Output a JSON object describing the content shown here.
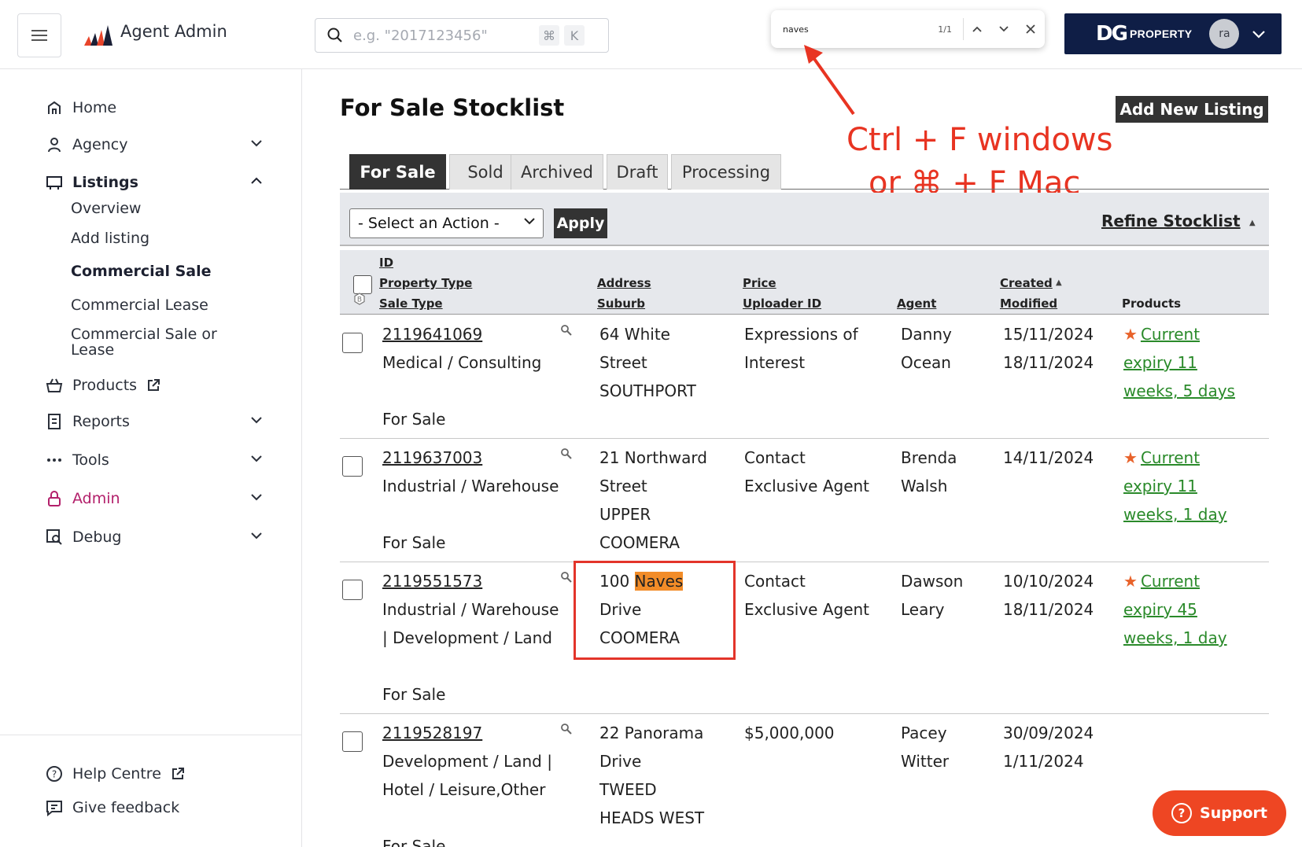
{
  "header": {
    "app_title": "Agent Admin",
    "search_placeholder": "e.g. \"2017123456\"",
    "shortcut_cmd": "⌘",
    "shortcut_key": "K",
    "find": {
      "query": "naves",
      "count": "1/1"
    },
    "brand": {
      "mark": "DG",
      "name": "PROPERTY",
      "avatar": "ra"
    },
    "brand_color": "#0f1e46"
  },
  "sidebar": {
    "items": [
      {
        "label": "Home",
        "icon": "home-icon"
      },
      {
        "label": "Agency",
        "icon": "user-icon"
      },
      {
        "label": "Listings",
        "icon": "listings-icon"
      },
      {
        "label": "Products",
        "icon": "basket-icon"
      },
      {
        "label": "Reports",
        "icon": "report-icon"
      },
      {
        "label": "Tools",
        "icon": "more-icon"
      },
      {
        "label": "Admin",
        "icon": "lock-icon"
      },
      {
        "label": "Debug",
        "icon": "debug-icon"
      }
    ],
    "sub_items": [
      "Overview",
      "Add listing",
      "Commercial Sale",
      "Commercial Lease",
      "Commercial Sale or Lease"
    ],
    "bottom": [
      "Help Centre",
      "Give feedback"
    ]
  },
  "main": {
    "title": "For Sale Stocklist",
    "add_button": "Add New Listing",
    "annotation_line1": "Ctrl + F windows",
    "annotation_line2": "or ⌘ + F Mac",
    "tabs": [
      "For Sale",
      "Sold",
      "Archived",
      "Draft",
      "Processing"
    ],
    "action_select": "- Select an Action -",
    "apply": "Apply",
    "refine": "Refine Stocklist",
    "columns": {
      "id": "ID",
      "property_type": "Property Type",
      "sale_type": "Sale Type",
      "address": "Address",
      "suburb": "Suburb",
      "price": "Price",
      "uploader": "Uploader ID",
      "agent": "Agent",
      "created": "Created",
      "modified": "Modified",
      "products": "Products"
    },
    "rows": [
      {
        "id": "2119641069",
        "type1": "Medical / Consulting",
        "type2": "",
        "sale": "For Sale",
        "addr": [
          "64 White",
          "Street",
          "SOUTHPORT",
          ""
        ],
        "price": [
          "Expressions of",
          "Interest"
        ],
        "agent": [
          "Danny",
          "Ocean"
        ],
        "created": "15/11/2024",
        "modified": "18/11/2024",
        "product": {
          "status": "Current",
          "l2": "expiry 11",
          "l3": "weeks, 5 days"
        }
      },
      {
        "id": "2119637003",
        "type1": "Industrial / Warehouse",
        "type2": "",
        "sale": "For Sale",
        "addr": [
          "21 Northward",
          "Street",
          "UPPER",
          "COOMERA"
        ],
        "price": [
          "Contact",
          "Exclusive Agent"
        ],
        "agent": [
          "Brenda",
          "Walsh"
        ],
        "created": "14/11/2024",
        "modified": "",
        "product": {
          "status": "Current",
          "l2": "expiry 11",
          "l3": "weeks, 1 day"
        }
      },
      {
        "id": "2119551573",
        "type1": "Industrial / Warehouse",
        "type2": "| Development / Land",
        "sale": "For Sale",
        "addr_prefix": "100 ",
        "addr_match": "Naves",
        "addr": [
          "",
          "Drive",
          "COOMERA",
          ""
        ],
        "price": [
          "Contact",
          "Exclusive Agent"
        ],
        "agent": [
          "Dawson",
          "Leary"
        ],
        "created": "10/10/2024",
        "modified": "18/11/2024",
        "product": {
          "status": "Current",
          "l2": "expiry 45",
          "l3": "weeks, 1 day"
        }
      },
      {
        "id": "2119528197",
        "type1": "Development / Land |",
        "type2": "Hotel / Leisure,Other",
        "sale": "For Sale",
        "addr": [
          "22 Panorama",
          "Drive",
          "TWEED",
          "HEADS WEST"
        ],
        "price": [
          "$5,000,000",
          ""
        ],
        "agent": [
          "Pacey",
          "Witter"
        ],
        "created": "30/09/2024",
        "modified": "1/11/2024",
        "product": {
          "status": "",
          "l2": "",
          "l3": ""
        }
      }
    ]
  },
  "support_label": "Support",
  "colors": {
    "accent_red": "#e3342a",
    "support": "#ee4623",
    "product_link": "#2a8a2a",
    "highlight": "#f28c28",
    "admin": "#b3206b"
  }
}
